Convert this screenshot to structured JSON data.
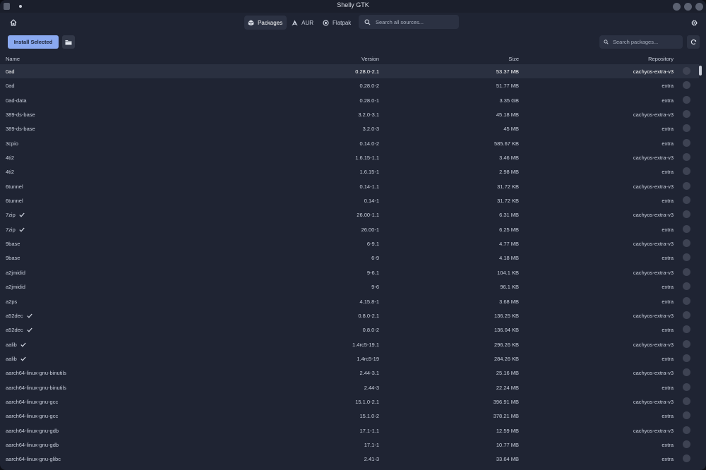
{
  "window": {
    "title": "Shelly GTK"
  },
  "header": {
    "tabs": [
      {
        "label": "Packages",
        "icon": "package-icon",
        "active": true
      },
      {
        "label": "AUR",
        "icon": "arch-icon",
        "active": false
      },
      {
        "label": "Flatpak",
        "icon": "flatpak-icon",
        "active": false
      }
    ],
    "search_placeholder": "Search all sources..."
  },
  "toolbar": {
    "install_label": "Install Selected",
    "search_placeholder": "Search packages..."
  },
  "table": {
    "columns": {
      "name": "Name",
      "version": "Version",
      "size": "Size",
      "repository": "Repository"
    },
    "rows": [
      {
        "name": "0ad",
        "version": "0.28.0-2.1",
        "size": "53.37 MB",
        "repo": "cachyos-extra-v3",
        "installed": false,
        "selected": true
      },
      {
        "name": "0ad",
        "version": "0.28.0-2",
        "size": "51.77 MB",
        "repo": "extra",
        "installed": false,
        "selected": false
      },
      {
        "name": "0ad-data",
        "version": "0.28.0-1",
        "size": "3.35 GB",
        "repo": "extra",
        "installed": false,
        "selected": false
      },
      {
        "name": "389-ds-base",
        "version": "3.2.0-3.1",
        "size": "45.18 MB",
        "repo": "cachyos-extra-v3",
        "installed": false,
        "selected": false
      },
      {
        "name": "389-ds-base",
        "version": "3.2.0-3",
        "size": "45 MB",
        "repo": "extra",
        "installed": false,
        "selected": false
      },
      {
        "name": "3cpio",
        "version": "0.14.0-2",
        "size": "585.67 KB",
        "repo": "extra",
        "installed": false,
        "selected": false
      },
      {
        "name": "4ti2",
        "version": "1.6.15-1.1",
        "size": "3.46 MB",
        "repo": "cachyos-extra-v3",
        "installed": false,
        "selected": false
      },
      {
        "name": "4ti2",
        "version": "1.6.15-1",
        "size": "2.98 MB",
        "repo": "extra",
        "installed": false,
        "selected": false
      },
      {
        "name": "6tunnel",
        "version": "0.14-1.1",
        "size": "31.72 KB",
        "repo": "cachyos-extra-v3",
        "installed": false,
        "selected": false
      },
      {
        "name": "6tunnel",
        "version": "0.14-1",
        "size": "31.72 KB",
        "repo": "extra",
        "installed": false,
        "selected": false
      },
      {
        "name": "7zip",
        "version": "26.00-1.1",
        "size": "6.31 MB",
        "repo": "cachyos-extra-v3",
        "installed": true,
        "selected": false
      },
      {
        "name": "7zip",
        "version": "26.00-1",
        "size": "6.25 MB",
        "repo": "extra",
        "installed": true,
        "selected": false
      },
      {
        "name": "9base",
        "version": "6-9.1",
        "size": "4.77 MB",
        "repo": "cachyos-extra-v3",
        "installed": false,
        "selected": false
      },
      {
        "name": "9base",
        "version": "6-9",
        "size": "4.18 MB",
        "repo": "extra",
        "installed": false,
        "selected": false
      },
      {
        "name": "a2jmidid",
        "version": "9-6.1",
        "size": "104.1 KB",
        "repo": "cachyos-extra-v3",
        "installed": false,
        "selected": false
      },
      {
        "name": "a2jmidid",
        "version": "9-6",
        "size": "96.1 KB",
        "repo": "extra",
        "installed": false,
        "selected": false
      },
      {
        "name": "a2ps",
        "version": "4.15.8-1",
        "size": "3.68 MB",
        "repo": "extra",
        "installed": false,
        "selected": false
      },
      {
        "name": "a52dec",
        "version": "0.8.0-2.1",
        "size": "136.25 KB",
        "repo": "cachyos-extra-v3",
        "installed": true,
        "selected": false
      },
      {
        "name": "a52dec",
        "version": "0.8.0-2",
        "size": "136.04 KB",
        "repo": "extra",
        "installed": true,
        "selected": false
      },
      {
        "name": "aalib",
        "version": "1.4rc5-19.1",
        "size": "296.26 KB",
        "repo": "cachyos-extra-v3",
        "installed": true,
        "selected": false
      },
      {
        "name": "aalib",
        "version": "1.4rc5-19",
        "size": "284.26 KB",
        "repo": "extra",
        "installed": true,
        "selected": false
      },
      {
        "name": "aarch64-linux-gnu-binutils",
        "version": "2.44-3.1",
        "size": "25.16 MB",
        "repo": "cachyos-extra-v3",
        "installed": false,
        "selected": false
      },
      {
        "name": "aarch64-linux-gnu-binutils",
        "version": "2.44-3",
        "size": "22.24 MB",
        "repo": "extra",
        "installed": false,
        "selected": false
      },
      {
        "name": "aarch64-linux-gnu-gcc",
        "version": "15.1.0-2.1",
        "size": "396.91 MB",
        "repo": "cachyos-extra-v3",
        "installed": false,
        "selected": false
      },
      {
        "name": "aarch64-linux-gnu-gcc",
        "version": "15.1.0-2",
        "size": "378.21 MB",
        "repo": "extra",
        "installed": false,
        "selected": false
      },
      {
        "name": "aarch64-linux-gnu-gdb",
        "version": "17.1-1.1",
        "size": "12.59 MB",
        "repo": "cachyos-extra-v3",
        "installed": false,
        "selected": false
      },
      {
        "name": "aarch64-linux-gnu-gdb",
        "version": "17.1-1",
        "size": "10.77 MB",
        "repo": "extra",
        "installed": false,
        "selected": false
      },
      {
        "name": "aarch64-linux-gnu-glibc",
        "version": "2.41-3",
        "size": "33.64 MB",
        "repo": "extra",
        "installed": false,
        "selected": false
      }
    ]
  },
  "colors": {
    "accent": "#8aa9f0",
    "background": "#1f2433",
    "selected_row": "#2a3040"
  }
}
